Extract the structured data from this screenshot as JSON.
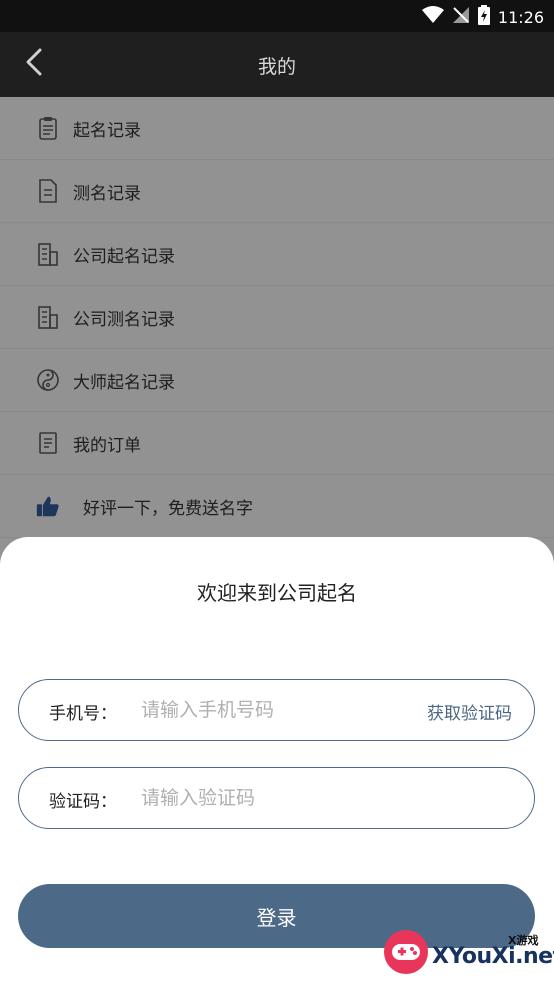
{
  "status_bar": {
    "time": "11:26"
  },
  "app_bar": {
    "title": "我的"
  },
  "menu": {
    "items": [
      {
        "label": "起名记录",
        "icon": "clipboard-icon"
      },
      {
        "label": "测名记录",
        "icon": "document-icon"
      },
      {
        "label": "公司起名记录",
        "icon": "building-icon"
      },
      {
        "label": "公司测名记录",
        "icon": "building-icon"
      },
      {
        "label": "大师起名记录",
        "icon": "yin-yang-icon"
      },
      {
        "label": "我的订单",
        "icon": "order-icon"
      },
      {
        "label": "好评一下，免费送名字",
        "icon": "thumbs-up-icon"
      }
    ]
  },
  "login_sheet": {
    "title": "欢迎来到公司起名",
    "phone_label": "手机号：",
    "phone_placeholder": "请输入手机号码",
    "get_code": "获取验证码",
    "code_label": "验证码：",
    "code_placeholder": "请输入验证码",
    "login_button": "登录"
  },
  "watermark": {
    "small": "X游戏",
    "main": "XYouXi.net"
  },
  "colors": {
    "accent": "#4d6988",
    "status_bar": "#111111",
    "app_bar": "#1f1f1f"
  }
}
